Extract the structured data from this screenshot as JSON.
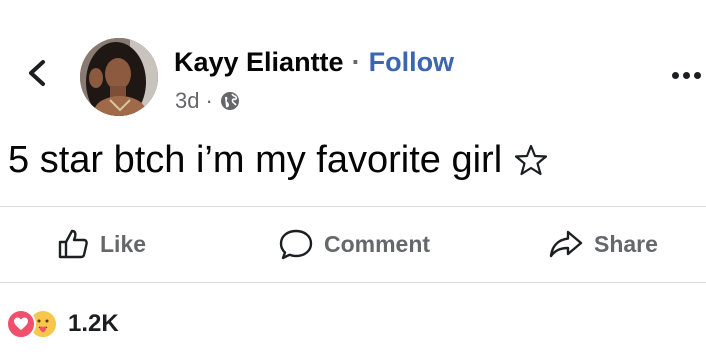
{
  "post": {
    "author": "Kayy Eliantte",
    "separator": "·",
    "follow_label": "Follow",
    "time": "3d",
    "time_separator": "·",
    "privacy_icon": "globe-icon",
    "text": "5 star btch i’m my favorite girl",
    "emoji_icon": "star-outline-icon"
  },
  "actions": {
    "like_label": "Like",
    "comment_label": "Comment",
    "share_label": "Share"
  },
  "reactions": {
    "types": [
      "love",
      "care"
    ],
    "count": "1.2K"
  },
  "colors": {
    "follow_link": "#3b66b0",
    "secondary_text": "#65676b",
    "divider": "#dadde1",
    "love_reaction": "#f0506e",
    "care_reaction": "#f7c64a"
  }
}
